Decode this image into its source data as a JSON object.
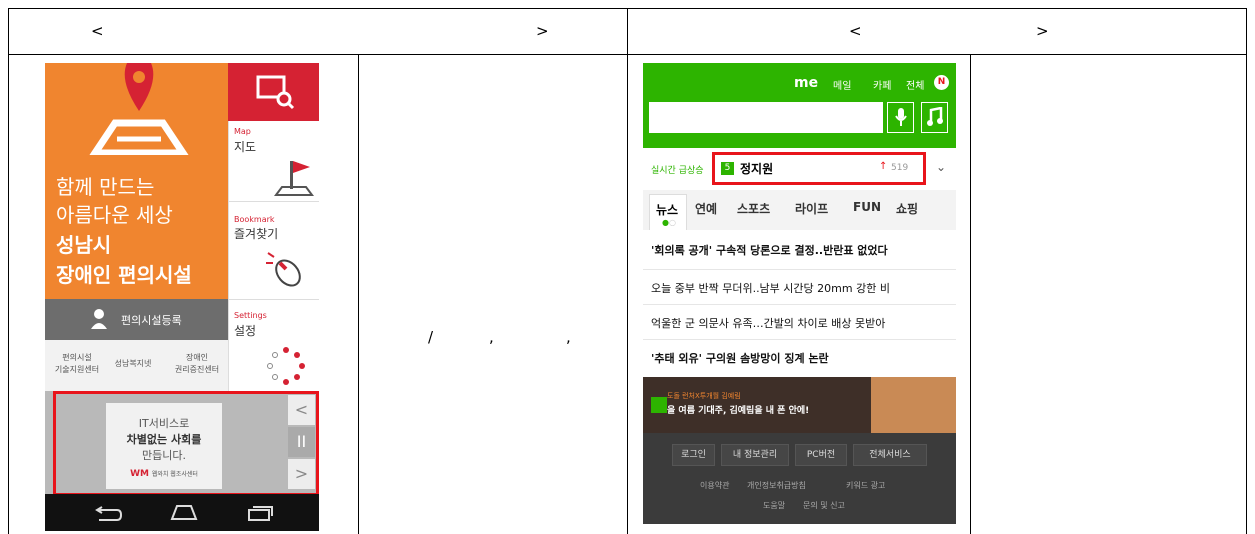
{
  "header": {
    "left_open": "<",
    "left_close": ">",
    "right_open": "<",
    "right_close": ">"
  },
  "middle_text": {
    "slash": "/",
    "comma1": ",",
    "comma2": ","
  },
  "app1": {
    "title_thin_1": "함께 만드는",
    "title_thin_2": "아름다운 세상",
    "title_bold_1": "성남시",
    "title_bold_2": "장애인 편의시설",
    "map_label": "Map",
    "map_title": "지도",
    "bookmark_label": "Bookmark",
    "bookmark_title": "즐겨찾기",
    "settings_label": "Settings",
    "settings_title": "설정",
    "register_label": "편의시설등록",
    "links": [
      {
        "line1": "편의시설",
        "line2": "기술지원센터"
      },
      {
        "line1": "성남복지넷",
        "line2": ""
      },
      {
        "line1": "장애인",
        "line2": "권리증진센터"
      }
    ],
    "banner_line1": "IT서비스로",
    "banner_line2": "차별없는 사회를",
    "banner_line3": "만듭니다.",
    "banner_logo": "WM",
    "banner_small": "웹와치 웹조사센터",
    "ctrl_prev": "<",
    "ctrl_pause": "II",
    "ctrl_next": ">",
    "colors": {
      "orange": "#f0852f",
      "red": "#d52233",
      "gray": "#6d6d6d"
    }
  },
  "app2": {
    "top_links": {
      "me": "me",
      "mail": "메일",
      "cafe": "카페",
      "all": "전체",
      "badge": "N"
    },
    "search_placeholder": "",
    "trending_label": "실시간 급상승",
    "trending_rank": "5",
    "trending_term": "정지원",
    "trending_count": "519",
    "tabs": [
      "뉴스",
      "연예",
      "스포츠",
      "라이프",
      "FUN",
      "쇼핑"
    ],
    "news": [
      "'회의록 공개' 구속적 당론으로 결정..반란표 없었다",
      "오늘 중부 반짝 무더위..남부 시간당 20mm 강한 비",
      "억울한 군 의문사 유족…간발의 차이로 배상 못받아",
      "'추태 외유' 구의원 솜방망이 징계 논란"
    ],
    "ad_small": "도돌 런처X투개월 김예림",
    "ad_main": "올 여름 기대주, 김예림을 내 폰 안에!",
    "footer_buttons": [
      "로그인",
      "내 정보관리",
      "PC버전",
      "전체서비스"
    ],
    "footer_links_row1": [
      "이용약관",
      "개인정보취급방침",
      "키워드 광고"
    ],
    "footer_links_row2": [
      "도움말",
      "문의 및 신고"
    ],
    "colors": {
      "green": "#2db400",
      "highlight": "#e8141b"
    }
  }
}
